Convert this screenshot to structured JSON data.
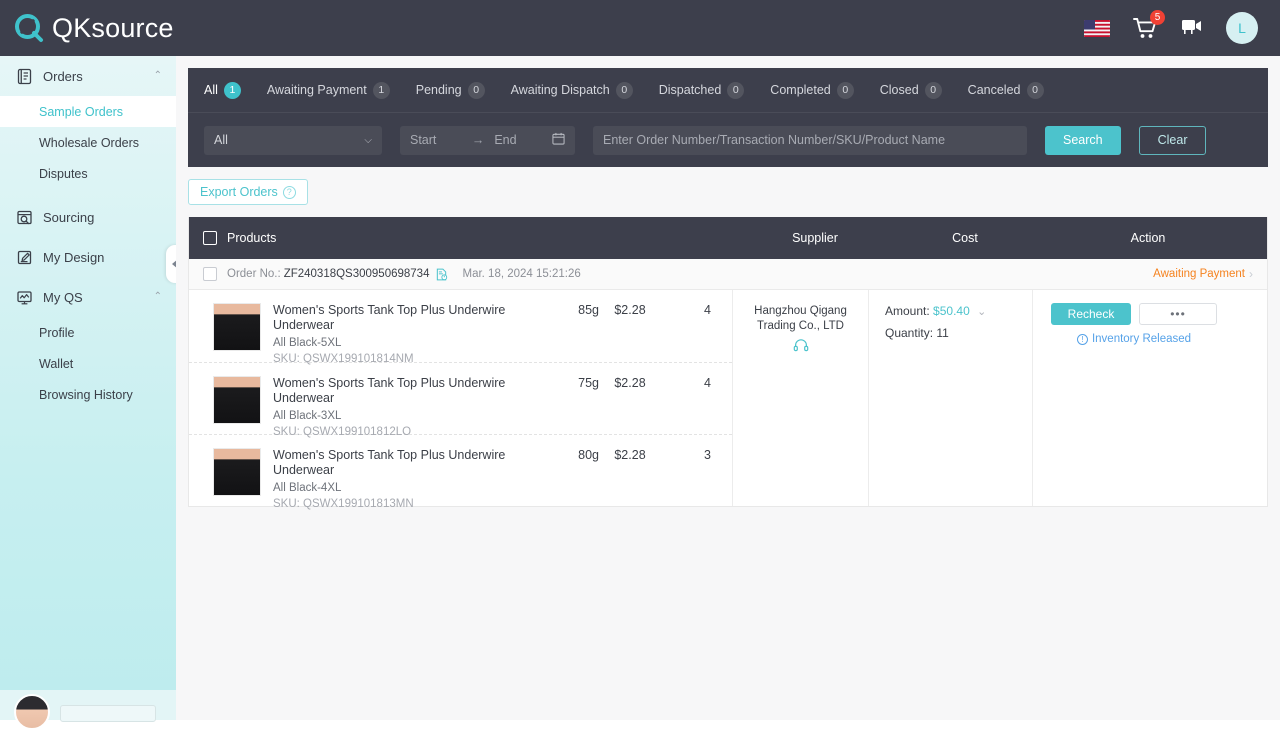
{
  "app": {
    "brand": "QKsource",
    "brand_accent": "#3fc2cb",
    "dark_bg": "#3d3f4c"
  },
  "topbar": {
    "language_icon": "us-flag-icon",
    "cart_icon": "cart-icon",
    "cart_badge": "5",
    "video_icon": "video-camera-icon",
    "avatar_initial": "L"
  },
  "sidebar": {
    "groups": [
      {
        "label": "Orders",
        "icon": "orders-icon",
        "expanded": true,
        "chevron": "⌃",
        "items": [
          {
            "label": "Sample Orders",
            "active": true
          },
          {
            "label": "Wholesale Orders",
            "active": false
          },
          {
            "label": "Disputes",
            "active": false
          }
        ]
      },
      {
        "label": "Sourcing",
        "icon": "sourcing-icon",
        "expanded": false,
        "items": []
      },
      {
        "label": "My Design",
        "icon": "design-icon",
        "expanded": false,
        "items": []
      },
      {
        "label": "My QS",
        "icon": "myqs-icon",
        "expanded": true,
        "chevron": "⌃",
        "items": [
          {
            "label": "Profile",
            "active": false
          },
          {
            "label": "Wallet",
            "active": false
          },
          {
            "label": "Browsing History",
            "active": false
          }
        ]
      }
    ],
    "collapse_handle": "collapse-sidebar-handle"
  },
  "tabs": [
    {
      "label": "All",
      "count": "1",
      "active": true
    },
    {
      "label": "Awaiting Payment",
      "count": "1",
      "active": false
    },
    {
      "label": "Pending",
      "count": "0",
      "active": false
    },
    {
      "label": "Awaiting Dispatch",
      "count": "0",
      "active": false
    },
    {
      "label": "Dispatched",
      "count": "0",
      "active": false
    },
    {
      "label": "Completed",
      "count": "0",
      "active": false
    },
    {
      "label": "Closed",
      "count": "0",
      "active": false
    },
    {
      "label": "Canceled",
      "count": "0",
      "active": false
    }
  ],
  "filters": {
    "select_value": "All",
    "date_start_placeholder": "Start",
    "date_end_placeholder": "End",
    "date_separator": "→",
    "calendar_icon": "calendar-icon",
    "search_placeholder": "Enter Order Number/Transaction Number/SKU/Product Name",
    "search_value": "",
    "search_button": "Search",
    "clear_button": "Clear"
  },
  "toolbar": {
    "export_label": "Export Orders",
    "export_help": "?"
  },
  "table": {
    "headers": {
      "products": "Products",
      "supplier": "Supplier",
      "cost": "Cost",
      "action": "Action"
    }
  },
  "order": {
    "order_no_label": "Order No.:",
    "order_no": "ZF240318QS300950698734",
    "copy_icon": "order-document-icon",
    "date": "Mar. 18, 2024 15:21:26",
    "status": "Awaiting Payment",
    "status_color": "#f58320",
    "status_chevron": "›",
    "items": [
      {
        "title": "Women's Sports Tank Top Plus Underwire Underwear",
        "variant": "All Black-5XL",
        "sku": "SKU: QSWX199101814NM",
        "weight": "85g",
        "price": "$2.28",
        "qty": "4"
      },
      {
        "title": "Women's Sports Tank Top Plus Underwire Underwear",
        "variant": "All Black-3XL",
        "sku": "SKU: QSWX199101812LO",
        "weight": "75g",
        "price": "$2.28",
        "qty": "4"
      },
      {
        "title": "Women's Sports Tank Top Plus Underwire Underwear",
        "variant": "All Black-4XL",
        "sku": "SKU: QSWX199101813MN",
        "weight": "80g",
        "price": "$2.28",
        "qty": "3"
      }
    ],
    "supplier": {
      "name_line1": "Hangzhou Qigang",
      "name_line2": "Trading Co., LTD",
      "contact_icon": "headset-icon"
    },
    "cost": {
      "amount_label": "Amount:",
      "amount_value": "$50.40",
      "amount_color": "#4cc3cc",
      "expand_chevron": "⌄",
      "quantity_label": "Quantity:",
      "quantity_value": "11"
    },
    "action": {
      "recheck_label": "Recheck",
      "more_label": "•••",
      "inventory_note": "Inventory Released",
      "inventory_icon": "info-icon"
    }
  }
}
